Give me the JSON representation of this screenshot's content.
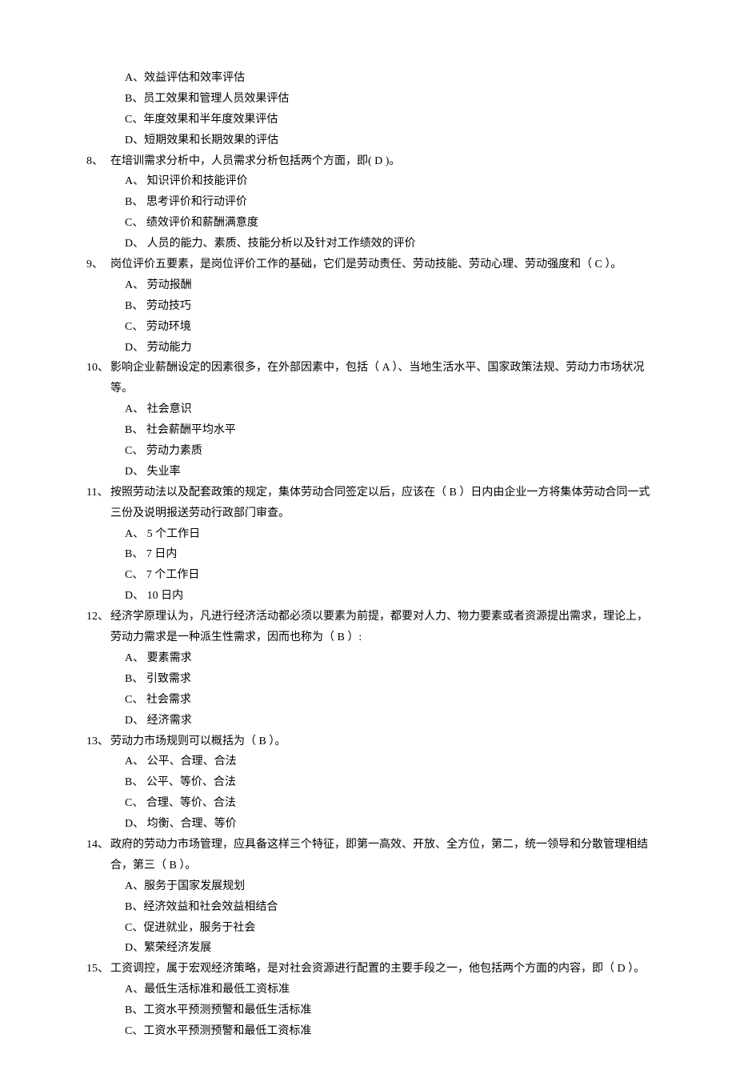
{
  "intro_options": [
    "A、效益评估和效率评估",
    "B、员工效果和管理人员效果评估",
    "C、年度效果和半年度效果评估",
    "D、短期效果和长期效果的评估"
  ],
  "questions": [
    {
      "num": "8、",
      "text": "在培训需求分析中，人员需求分析包括两个方面，即( D )。",
      "options": [
        "A、  知识评价和技能评价",
        "B、  思考评价和行动评价",
        "C、  绩效评价和薪酬满意度",
        "D、  人员的能力、素质、技能分析以及针对工作绩效的评价"
      ]
    },
    {
      "num": "9、",
      "text": "岗位评价五要素，是岗位评价工作的基础，它们是劳动责任、劳动技能、劳动心理、劳动强度和（  C  ）。",
      "options": [
        "A、  劳动报酬",
        "B、  劳动技巧",
        "C、  劳动环境",
        "D、  劳动能力"
      ]
    },
    {
      "num": "10、",
      "text": "影响企业薪酬设定的因素很多，在外部因素中，包括（  A  ）、当地生活水平、国家政策法规、劳动力市场状况等。",
      "options": [
        "A、  社会意识",
        "B、  社会薪酬平均水平",
        "C、  劳动力素质",
        "D、  失业率"
      ]
    },
    {
      "num": "11、",
      "text": "按照劳动法以及配套政策的规定，集体劳动合同签定以后，应该在（  B  ）日内由企业一方将集体劳动合同一式三份及说明报送劳动行政部门审查。",
      "options": [
        "A、  5 个工作日",
        "B、  7 日内",
        "C、  7 个工作日",
        "D、  10 日内"
      ]
    },
    {
      "num": "12、",
      "text": "经济学原理认为，凡进行经济活动都必须以要素为前提，都要对人力、物力要素或者资源提出需求，理论上，劳动力需求是一种派生性需求，因而也称为（  B  ）:",
      "options": [
        "A、  要素需求",
        "B、  引致需求",
        "C、  社会需求",
        "D、  经济需求"
      ]
    },
    {
      "num": "13、",
      "text": "劳动力市场规则可以概括为（  B  ）。",
      "options": [
        "A、  公平、合理、合法",
        "B、  公平、等价、合法",
        "C、  合理、等价、合法",
        "D、  均衡、合理、等价"
      ]
    },
    {
      "num": "14、",
      "text": "政府的劳动力市场管理，应具备这样三个特征，即第一高效、开放、全方位，第二，统一领导和分散管理相结合，第三（  B  ）。",
      "options": [
        "A、服务于国家发展规划",
        "B、经济效益和社会效益相结合",
        "C、促进就业，服务于社会",
        "D、繁荣经济发展"
      ]
    },
    {
      "num": "15、",
      "text": "工资调控，属于宏观经济策略，是对社会资源进行配置的主要手段之一，他包括两个方面的内容，即（  D  ）。",
      "options": [
        "A、最低生活标准和最低工资标准",
        "B、工资水平预测预警和最低生活标准",
        "C、工资水平预测预警和最低工资标准"
      ]
    }
  ]
}
